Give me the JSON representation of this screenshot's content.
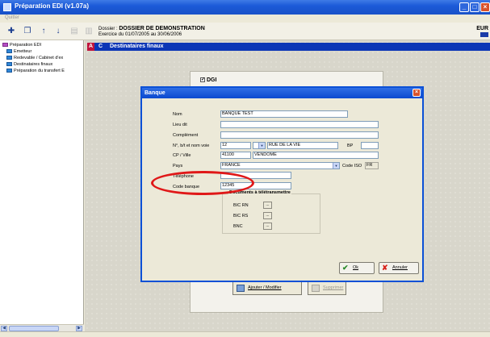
{
  "window": {
    "title": "Préparation EDI (v1.07a)",
    "minimize": "_",
    "maximize": "□",
    "close": "×"
  },
  "menu": {
    "item": "Quitter"
  },
  "toolbar": {
    "icons": [
      "new-icon",
      "copy-icon",
      "up-arrow-icon",
      "down-arrow-icon",
      "print-icon",
      "preview-icon"
    ],
    "dossier_label": "Dossier :",
    "dossier_name": "DOSSIER DE DEMONSTRATION",
    "exercice": "Exercice du 01/07/2005 au 30/06/2006",
    "currency": "EUR"
  },
  "sidebar": {
    "items": [
      {
        "label": "Préparation EDI",
        "icon": "folder-icon"
      },
      {
        "label": "Emetteur",
        "icon": "sheet-icon"
      },
      {
        "label": "Redevable / Cabinet d'ex",
        "icon": "sheet-icon"
      },
      {
        "label": "Destinataires finaux",
        "icon": "sheet-icon"
      },
      {
        "label": "Préparation du transfert E",
        "icon": "sheet-icon"
      }
    ]
  },
  "section": {
    "tag_a": "A",
    "tag_c": "C",
    "title": "Destinataires finaux"
  },
  "panel": {
    "dgi_label": "DGI",
    "dgi_checked": true,
    "add_button": "Ajouter / Modifier",
    "delete_button": "Supprimer"
  },
  "dialog": {
    "title": "Banque",
    "close": "×",
    "fields": {
      "nom_label": "Nom",
      "nom_value": "BANQUE TEST",
      "lieudit_label": "Lieu dit",
      "lieudit_value": "",
      "complement_label": "Complément",
      "complement_value": "",
      "adresse_label": "N°, b/t et nom voie",
      "numero_value": "12",
      "btq_value": "",
      "voie_value": "RUE DE LA VIE",
      "bp_label": "BP",
      "bp_value": "",
      "cpville_label": "CP / Ville",
      "cp_value": "41100",
      "ville_value": "VENDOME",
      "pays_label": "Pays",
      "pays_value": "FRANCE",
      "codeiso_label": "Code ISO",
      "codeiso_value": "FR",
      "telephone_label": "Téléphone",
      "telephone_value": "",
      "codebanque_label": "Code banque",
      "codebanque_value": "12345"
    },
    "documents": {
      "title": "Documents à télétransmettre",
      "items": [
        "BIC RN",
        "BIC RS",
        "BNC"
      ],
      "button": "..."
    },
    "ok_button": "Ok",
    "cancel_button": "Annuler"
  }
}
